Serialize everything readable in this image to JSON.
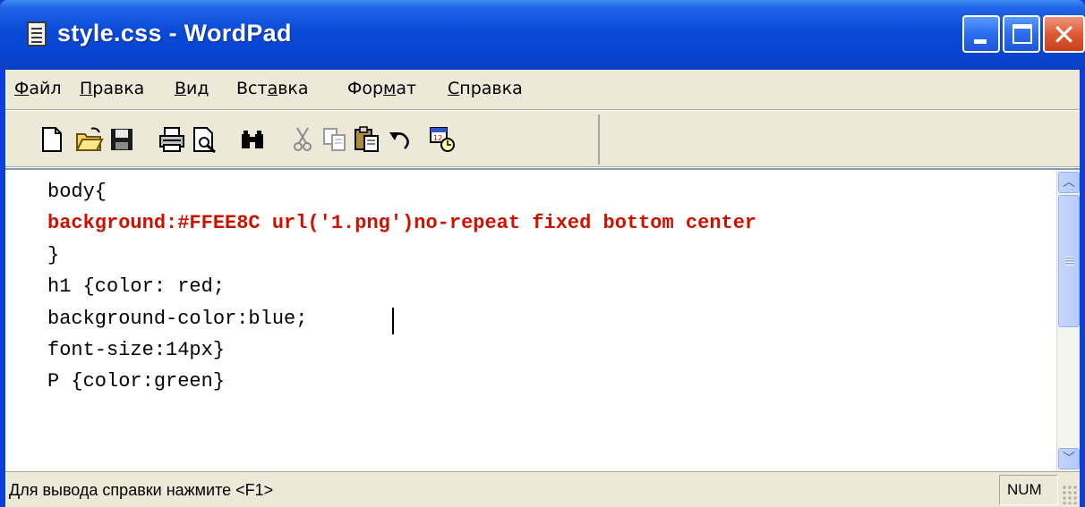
{
  "window": {
    "title": "style.css - WordPad",
    "controls": {
      "minimize": "minimize",
      "maximize": "maximize",
      "close": "close"
    }
  },
  "menu": [
    {
      "label": "Файл",
      "accel": "Ф",
      "rest": "айл"
    },
    {
      "label": "Правка",
      "accel": "П",
      "rest": "равка"
    },
    {
      "label": "Вид",
      "accel": "В",
      "rest": "ид"
    },
    {
      "label": "Вставка",
      "pre": "Вст",
      "accel": "а",
      "rest": "вка"
    },
    {
      "label": "Формат",
      "pre": "Фор",
      "accel": "м",
      "rest": "ат"
    },
    {
      "label": "Справка",
      "accel": "С",
      "rest": "правка"
    }
  ],
  "toolbar": [
    "new-document-icon",
    "open-folder-icon",
    "save-disk-icon",
    "print-icon",
    "print-preview-icon",
    "find-binoculars-icon",
    "cut-scissors-icon",
    "copy-icon",
    "paste-icon",
    "undo-icon",
    "insert-date-time-icon"
  ],
  "editor": {
    "lines": [
      {
        "text": "body{",
        "bold": false
      },
      {
        "text": "background:#FFEE8C url('1.png')no-repeat fixed bottom center",
        "bold": true
      },
      {
        "text": "}",
        "bold": false
      },
      {
        "text": "h1 {color: red;",
        "bold": false
      },
      {
        "text": "background-color:blue;",
        "bold": false
      },
      {
        "text": "font-size:14px}",
        "bold": false
      },
      {
        "text": "P {color:green}",
        "bold": false
      }
    ]
  },
  "statusbar": {
    "help_text": "Для вывода справки нажмите <F1>",
    "num_indicator": "NUM"
  },
  "colors": {
    "titlebar": "#0a4ad8",
    "highlight_text": "#cc1100",
    "chrome": "#ece9d8"
  }
}
